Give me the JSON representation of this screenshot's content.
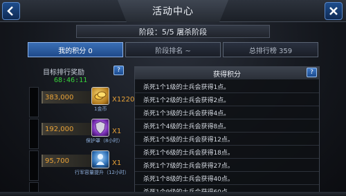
{
  "window": {
    "title": "活动中心"
  },
  "stage": {
    "text": "阶段：5/5 屠杀阶段"
  },
  "tabs": [
    {
      "label": "我的积分 0"
    },
    {
      "label": "阶段排名 ~"
    },
    {
      "label": "总排行榜 359"
    }
  ],
  "rewards": {
    "title": "目标排行奖励",
    "timer": "68:46:11",
    "help": "?",
    "items": [
      {
        "score": "383,000",
        "item_name": "1金币",
        "count": "X1220",
        "icon": "gold-coins-icon"
      },
      {
        "score": "192,000",
        "item_name": "保护罩（8小时）",
        "count": "X1",
        "icon": "shield-icon"
      },
      {
        "score": "95,700",
        "item_name": "行军容量提升（12小时）",
        "count": "X1",
        "icon": "march-capacity-icon"
      }
    ]
  },
  "points": {
    "title": "获得积分",
    "help": "?",
    "rules": [
      "杀死1个1级的士兵会获得1点。",
      "杀死1个2级的士兵会获得2点。",
      "杀死1个3级的士兵会获得4点。",
      "杀死1个4级的士兵会获得8点。",
      "杀死1个5级的士兵会获得12点。",
      "杀死1个6级的士兵会获得18点。",
      "杀死1个7级的士兵会获得27点。",
      "杀死1个8级的士兵会获得40点。",
      "杀死1个9级的士兵会获得60点。"
    ]
  }
}
